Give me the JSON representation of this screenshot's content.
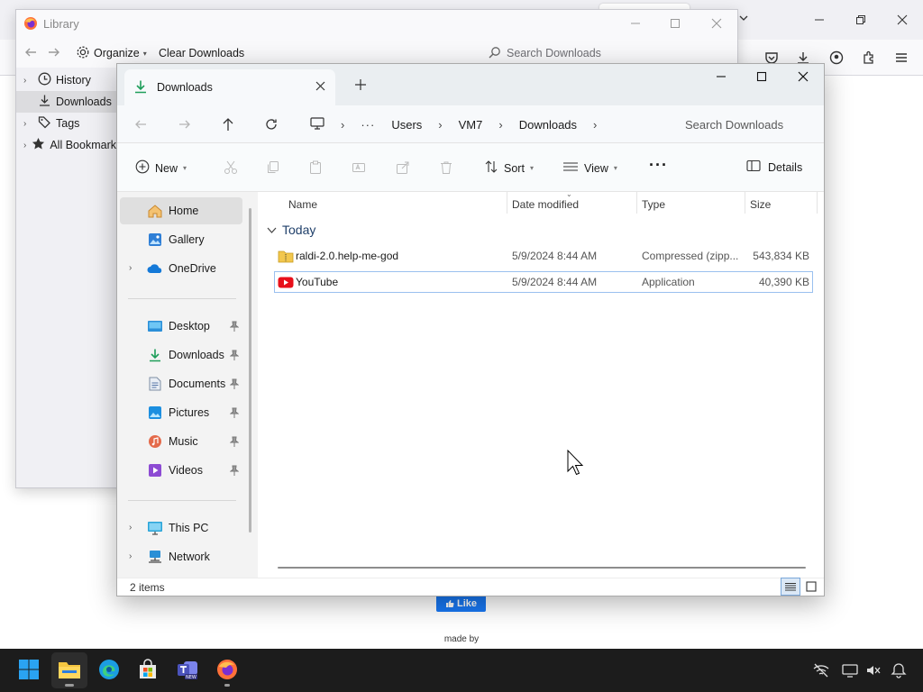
{
  "firefox": {
    "like_label": "Like",
    "made_by": "made by"
  },
  "library": {
    "title": "Library",
    "organize_label": "Organize",
    "clear_downloads_label": "Clear Downloads",
    "search_placeholder": "Search Downloads",
    "sidebar": [
      {
        "label": "History",
        "icon": "clock-icon"
      },
      {
        "label": "Downloads",
        "icon": "download-icon"
      },
      {
        "label": "Tags",
        "icon": "tag-icon"
      },
      {
        "label": "All Bookmarks",
        "icon": "star-icon"
      }
    ]
  },
  "explorer": {
    "tab_title": "Downloads",
    "breadcrumb": [
      "Users",
      "VM7",
      "Downloads"
    ],
    "search_placeholder": "Search Downloads",
    "commands": {
      "new": "New",
      "sort": "Sort",
      "view": "View",
      "details": "Details"
    },
    "nav": {
      "home": "Home",
      "gallery": "Gallery",
      "onedrive": "OneDrive",
      "desktop": "Desktop",
      "downloads": "Downloads",
      "documents": "Documents",
      "pictures": "Pictures",
      "music": "Music",
      "videos": "Videos",
      "this_pc": "This PC",
      "network": "Network"
    },
    "columns": {
      "name": "Name",
      "date": "Date modified",
      "type": "Type",
      "size": "Size"
    },
    "group": "Today",
    "files": [
      {
        "name": "raldi-2.0.help-me-god",
        "date": "5/9/2024 8:44 AM",
        "type": "Compressed (zipp...",
        "size": "543,834 KB",
        "icon": "zip-folder-icon"
      },
      {
        "name": "YouTube",
        "date": "5/9/2024 8:44 AM",
        "type": "Application",
        "size": "40,390 KB",
        "icon": "youtube-icon"
      }
    ],
    "status": "2 items"
  },
  "colors": {
    "accent": "#0067c0",
    "taskbar": "#1c1c1c",
    "download_green": "#1e9e5a"
  }
}
